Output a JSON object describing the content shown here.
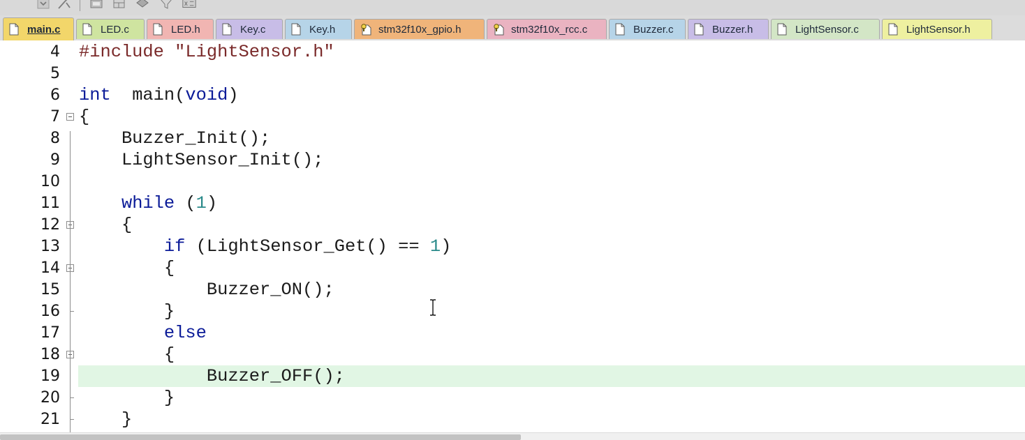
{
  "toolbar": {
    "buttons": [
      {
        "icon": "dropdown-icon"
      },
      {
        "icon": "wizard-icon"
      },
      {
        "icon": "project-icon"
      },
      {
        "icon": "window-layout-icon"
      },
      {
        "icon": "manage-components-icon"
      },
      {
        "icon": "filter-icon"
      },
      {
        "icon": "configure-icon"
      }
    ]
  },
  "tabs": [
    {
      "label": "main.c",
      "color": "#f2d66a",
      "active": true,
      "icon": "file-icon"
    },
    {
      "label": "LED.c",
      "color": "#cfe4a0",
      "active": false,
      "icon": "file-icon"
    },
    {
      "label": "LED.h",
      "color": "#f1b5b2",
      "active": false,
      "icon": "file-icon"
    },
    {
      "label": "Key.c",
      "color": "#c8bde7",
      "active": false,
      "icon": "file-icon"
    },
    {
      "label": "Key.h",
      "color": "#b6d4e8",
      "active": false,
      "icon": "file-icon"
    },
    {
      "label": "stm32f10x_gpio.h",
      "color": "#f0b47a",
      "active": false,
      "icon": "locked-file-icon"
    },
    {
      "label": "stm32f10x_rcc.c",
      "color": "#eab3c1",
      "active": false,
      "icon": "locked-file-icon"
    },
    {
      "label": "Buzzer.c",
      "color": "#b6d4e8",
      "active": false,
      "icon": "file-icon"
    },
    {
      "label": "Buzzer.h",
      "color": "#c8bde7",
      "active": false,
      "icon": "file-icon"
    },
    {
      "label": "LightSensor.c",
      "color": "#d3e6c6",
      "active": false,
      "icon": "file-icon"
    },
    {
      "label": "LightSensor.h",
      "color": "#eef0a0",
      "active": false,
      "icon": "file-icon"
    }
  ],
  "editor": {
    "current_line": 19,
    "lines": [
      {
        "n": "4",
        "fold": "",
        "tokens": [
          [
            "pp",
            "#include "
          ],
          [
            "str",
            "\"LightSensor.h\""
          ]
        ]
      },
      {
        "n": "5",
        "fold": "",
        "tokens": []
      },
      {
        "n": "6",
        "fold": "",
        "tokens": [
          [
            "kw",
            "int"
          ],
          [
            "",
            "  main("
          ],
          [
            "kw",
            "void"
          ],
          [
            "",
            ")"
          ]
        ]
      },
      {
        "n": "7",
        "fold": "open",
        "tokens": [
          [
            "",
            "{"
          ]
        ]
      },
      {
        "n": "8",
        "fold": "line",
        "tokens": [
          [
            "",
            "    Buzzer_Init();"
          ]
        ]
      },
      {
        "n": "9",
        "fold": "line",
        "tokens": [
          [
            "",
            "    LightSensor_Init();"
          ]
        ]
      },
      {
        "n": "10",
        "fold": "line",
        "tokens": []
      },
      {
        "n": "11",
        "fold": "line",
        "tokens": [
          [
            "",
            "    "
          ],
          [
            "kw",
            "while"
          ],
          [
            "",
            " ("
          ],
          [
            "num",
            "1"
          ],
          [
            "",
            ")"
          ]
        ]
      },
      {
        "n": "12",
        "fold": "open",
        "tokens": [
          [
            "",
            "    {"
          ]
        ]
      },
      {
        "n": "13",
        "fold": "line",
        "tokens": [
          [
            "",
            "        "
          ],
          [
            "kw",
            "if"
          ],
          [
            "",
            " (LightSensor_Get() == "
          ],
          [
            "num",
            "1"
          ],
          [
            "",
            ")"
          ]
        ]
      },
      {
        "n": "14",
        "fold": "open",
        "tokens": [
          [
            "",
            "        {"
          ]
        ]
      },
      {
        "n": "15",
        "fold": "line",
        "tokens": [
          [
            "",
            "            Buzzer_ON();"
          ]
        ]
      },
      {
        "n": "16",
        "fold": "end",
        "tokens": [
          [
            "",
            "        }"
          ]
        ]
      },
      {
        "n": "17",
        "fold": "line",
        "tokens": [
          [
            "",
            "        "
          ],
          [
            "kw",
            "else"
          ]
        ]
      },
      {
        "n": "18",
        "fold": "open",
        "tokens": [
          [
            "",
            "        {"
          ]
        ]
      },
      {
        "n": "19",
        "fold": "line",
        "tokens": [
          [
            "",
            "            Buzzer_OFF();"
          ]
        ]
      },
      {
        "n": "20",
        "fold": "end",
        "tokens": [
          [
            "",
            "        }"
          ]
        ]
      },
      {
        "n": "21",
        "fold": "end",
        "tokens": [
          [
            "",
            "    }"
          ]
        ]
      }
    ]
  }
}
